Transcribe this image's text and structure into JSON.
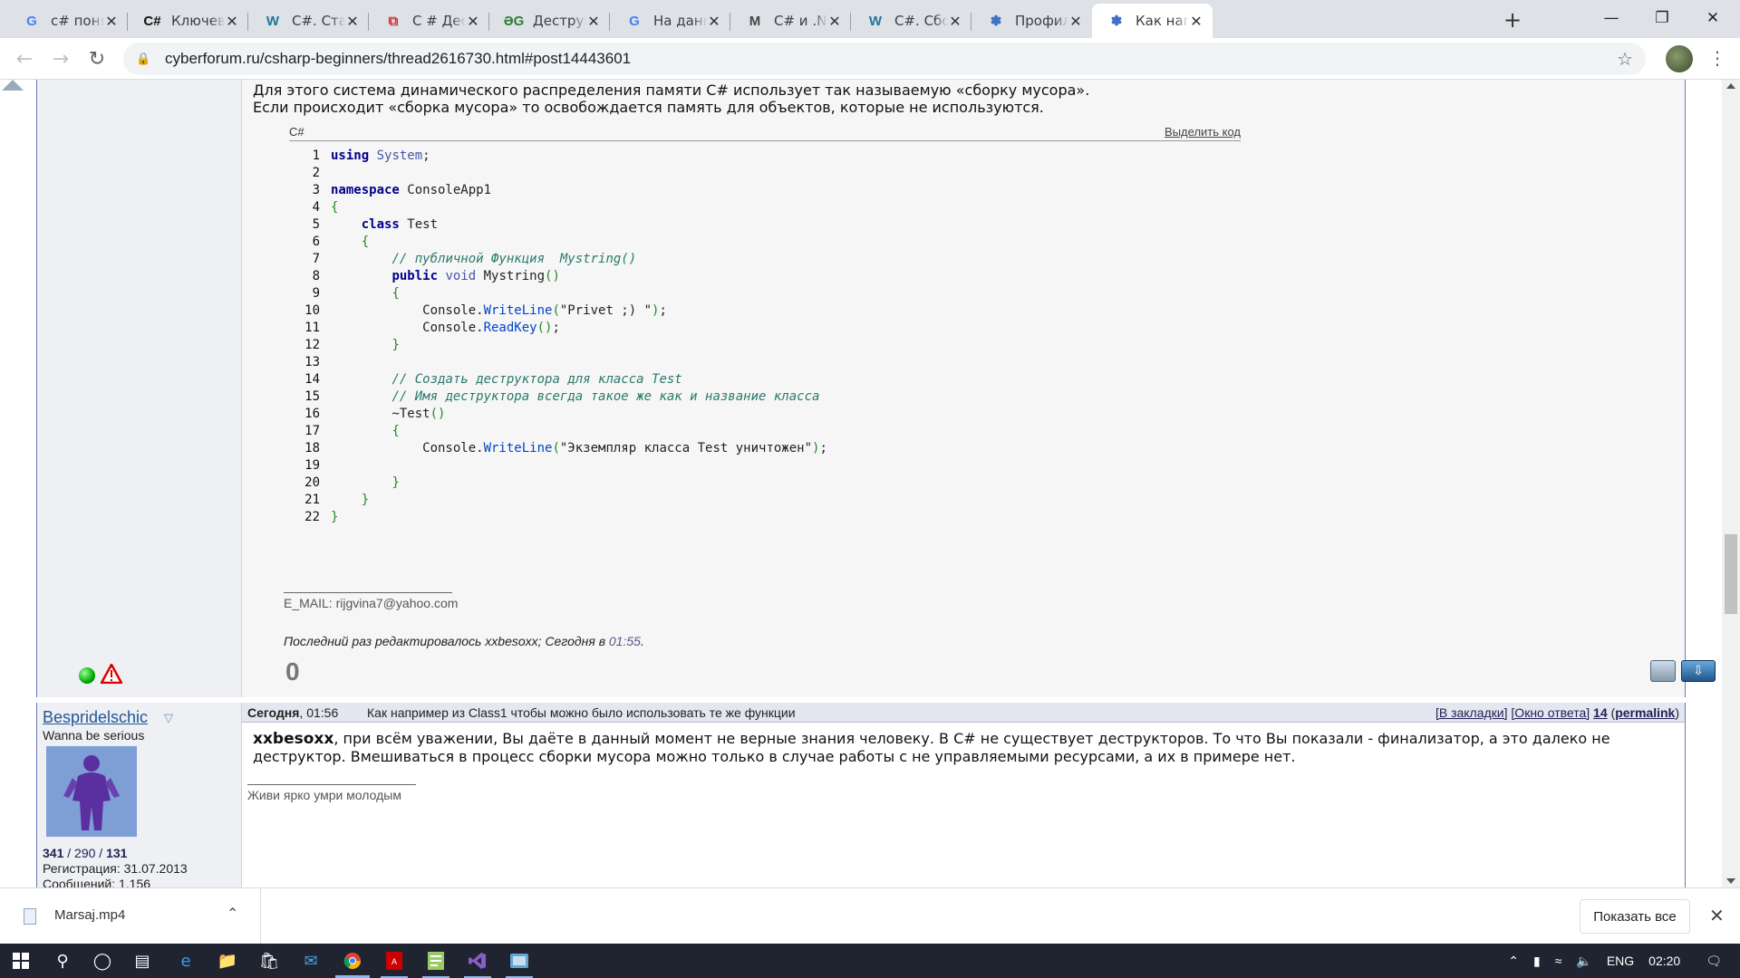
{
  "tabs": [
    {
      "label": "c# понятия static",
      "icon": "google-icon",
      "icon_char": "G",
      "icon_color": "#4285f4",
      "active": false
    },
    {
      "label": "Ключевое слово",
      "icon": "csharp-icon",
      "icon_char": "C#",
      "icon_color": "#111111",
      "active": false
    },
    {
      "label": "C#. Статические",
      "icon": "wordpress-icon",
      "icon_char": "W",
      "icon_color": "#21759b",
      "active": false
    },
    {
      "label": "C # Деструктор",
      "icon": "copy-icon",
      "icon_char": "⧉",
      "icon_color": "#d32f2f",
      "active": false
    },
    {
      "label": "Деструкторы",
      "icon": "dg-icon",
      "icon_char": "ƏG",
      "icon_color": "#2e7d32",
      "active": false
    },
    {
      "label": "На данных примерах",
      "icon": "google-icon",
      "icon_char": "G",
      "icon_color": "#4285f4",
      "active": false
    },
    {
      "label": "C# и .NET | Сборка",
      "icon": "metanit-icon",
      "icon_char": "M",
      "icon_color": "#444444",
      "active": false
    },
    {
      "label": "C#. Сборка мусора",
      "icon": "wordpress-icon",
      "icon_char": "W",
      "icon_color": "#21759b",
      "active": false
    },
    {
      "label": "Профиль - Cyberforum",
      "icon": "cyberforum-icon",
      "icon_char": "✽",
      "icon_color": "#3b6fc4",
      "active": false
    },
    {
      "label": "Как например из",
      "icon": "cyberforum-icon",
      "icon_char": "✽",
      "icon_color": "#3b6fc4",
      "active": true
    }
  ],
  "toolbar": {
    "url": "cyberforum.ru/csharp-beginners/thread2616730.html#post14443601"
  },
  "post1": {
    "text_line1": "Для этого система динамического распределения памяти C# использует так называемую «сборку мусора».",
    "text_line2": "Если происходит «сборка мусора» то освобождается память для объектов, которые не используются.",
    "code_lang": "C#",
    "select_code": "Выделить код",
    "signature": "E_MAIL: rijgvina7@yahoo.com",
    "edited_prefix": "Последний раз редактировалось xxbesoxx; Сегодня в ",
    "edited_time": "01:55",
    "edited_suffix": ".",
    "rating": "0"
  },
  "code": [
    {
      "n": "1",
      "html": "<span class=\"kw\">using</span> <span class=\"kw2\">System</span>;"
    },
    {
      "n": "2",
      "html": ""
    },
    {
      "n": "3",
      "html": "<span class=\"kw\">namespace</span> ConsoleApp1"
    },
    {
      "n": "4",
      "html": "<span class=\"br\">{</span>"
    },
    {
      "n": "5",
      "html": "    <span class=\"kw\">class</span> Test"
    },
    {
      "n": "6",
      "html": "    <span class=\"br\">{</span>"
    },
    {
      "n": "7",
      "html": "        <span class=\"cm\">// публичной Функция  Mystring()</span>"
    },
    {
      "n": "8",
      "html": "        <span class=\"kw\">public</span> <span class=\"kw2\">void</span> Mystring<span class=\"br\">()</span>"
    },
    {
      "n": "9",
      "html": "        <span class=\"br\">{</span>"
    },
    {
      "n": "10",
      "html": "            Console.<span class=\"mt\">WriteLine</span><span class=\"br\">(</span>\"Privet ;) \"<span class=\"br\">)</span>;"
    },
    {
      "n": "11",
      "html": "            Console.<span class=\"mt\">ReadKey</span><span class=\"br\">()</span>;"
    },
    {
      "n": "12",
      "html": "        <span class=\"br\">}</span>"
    },
    {
      "n": "13",
      "html": ""
    },
    {
      "n": "14",
      "html": "        <span class=\"cm\">// Создать деструктора для класса Test</span>"
    },
    {
      "n": "15",
      "html": "        <span class=\"cm\">// Имя деструктора всегда такое же как и название класса</span>"
    },
    {
      "n": "16",
      "html": "        ~Test<span class=\"br\">()</span>"
    },
    {
      "n": "17",
      "html": "        <span class=\"br\">{</span>"
    },
    {
      "n": "18",
      "html": "            Console.<span class=\"mt\">WriteLine</span><span class=\"br\">(</span>\"Экземпляр класса Test уничтожен\"<span class=\"br\">)</span>;"
    },
    {
      "n": "19",
      "html": ""
    },
    {
      "n": "20",
      "html": "        <span class=\"br\">}</span>"
    },
    {
      "n": "21",
      "html": "    <span class=\"br\">}</span>"
    },
    {
      "n": "22",
      "html": "<span class=\"br\">}</span>"
    }
  ],
  "post2": {
    "date": "Сегодня",
    "time": ", 01:56",
    "title": "Как например из Class1 чтобы можно было использовать те же функции",
    "bookmarks": "[В закладки]",
    "reply_window": "[Окно ответа]",
    "post_number": "14",
    "permalink": "permalink",
    "username": "Bespridelschic",
    "user_status": "Wanna be serious",
    "stat1": "341",
    "stat2": "290",
    "stat3": "131",
    "registration": "Регистрация: 31.07.2013",
    "messages": "Сообщений: 1,156",
    "body_user": "xxbesoxx",
    "body_rest": ", при всём уважении, Вы даёте в данный момент не верные знания человеку. В C# не существует деструкторов. То что Вы показали - финализатор, а это далеко не деструктор. Вмешиваться в процесс сборки мусора можно только в случае работы с не управляемыми ресурсами, а их в примере нет.",
    "signature": "Живи ярко умри молодым"
  },
  "downloads": {
    "file_name": "Marsaj.mp4",
    "show_all": "Показать все"
  },
  "taskbar": {
    "language": "ENG",
    "clock": "02:20"
  }
}
